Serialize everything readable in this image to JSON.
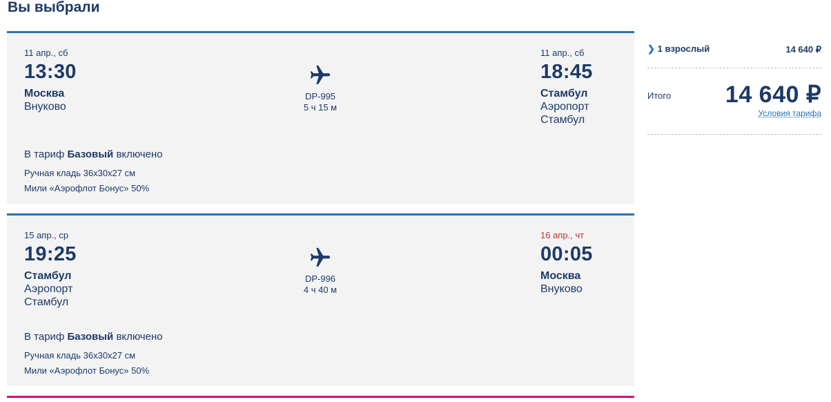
{
  "title": "Вы выбрали",
  "flights": [
    {
      "departure": {
        "date": "11 апр., сб",
        "time": "13:30",
        "city": "Москва",
        "airport": "Внуково"
      },
      "arrival": {
        "date": "11 апр., сб",
        "time": "18:45",
        "city": "Стамбул",
        "airport": "Аэропорт Стамбул",
        "date_color": "#1d3a66"
      },
      "flight_number": "DP-995",
      "duration": "5 ч 15 м",
      "tariff": {
        "prefix": "В тариф",
        "name": "Базовый",
        "suffix": "включено"
      },
      "included": [
        "Ручная кладь 36х30х27 см",
        "Мили «Аэрофлот Бонус» 50%"
      ]
    },
    {
      "departure": {
        "date": "15 апр., ср",
        "time": "19:25",
        "city": "Стамбул",
        "airport": "Аэропорт Стамбул"
      },
      "arrival": {
        "date": "16 апр., чт",
        "time": "00:05",
        "city": "Москва",
        "airport": "Внуково",
        "date_color": "#c0322c"
      },
      "flight_number": "DP-996",
      "duration": "4 ч 40 м",
      "tariff": {
        "prefix": "В тариф",
        "name": "Базовый",
        "suffix": "включено"
      },
      "included": [
        "Ручная кладь 36х30х27 см",
        "Мили «Аэрофлот Бонус» 50%"
      ]
    }
  ],
  "summary": {
    "passengers_label": "1 взрослый",
    "passengers_price": "14 640 ₽",
    "total_label": "Итого",
    "total_price": "14 640 ₽",
    "tariff_conditions_link": "Условия тарифа"
  },
  "icons": {
    "flight": "plane-icon",
    "expand": "chevron-right-icon"
  },
  "colors": {
    "primary": "#1d3a66",
    "accent": "#2873b4",
    "highlight_date": "#c0322c",
    "bottom_bar": "#d6136e",
    "card_bg": "#f3f3f4"
  }
}
